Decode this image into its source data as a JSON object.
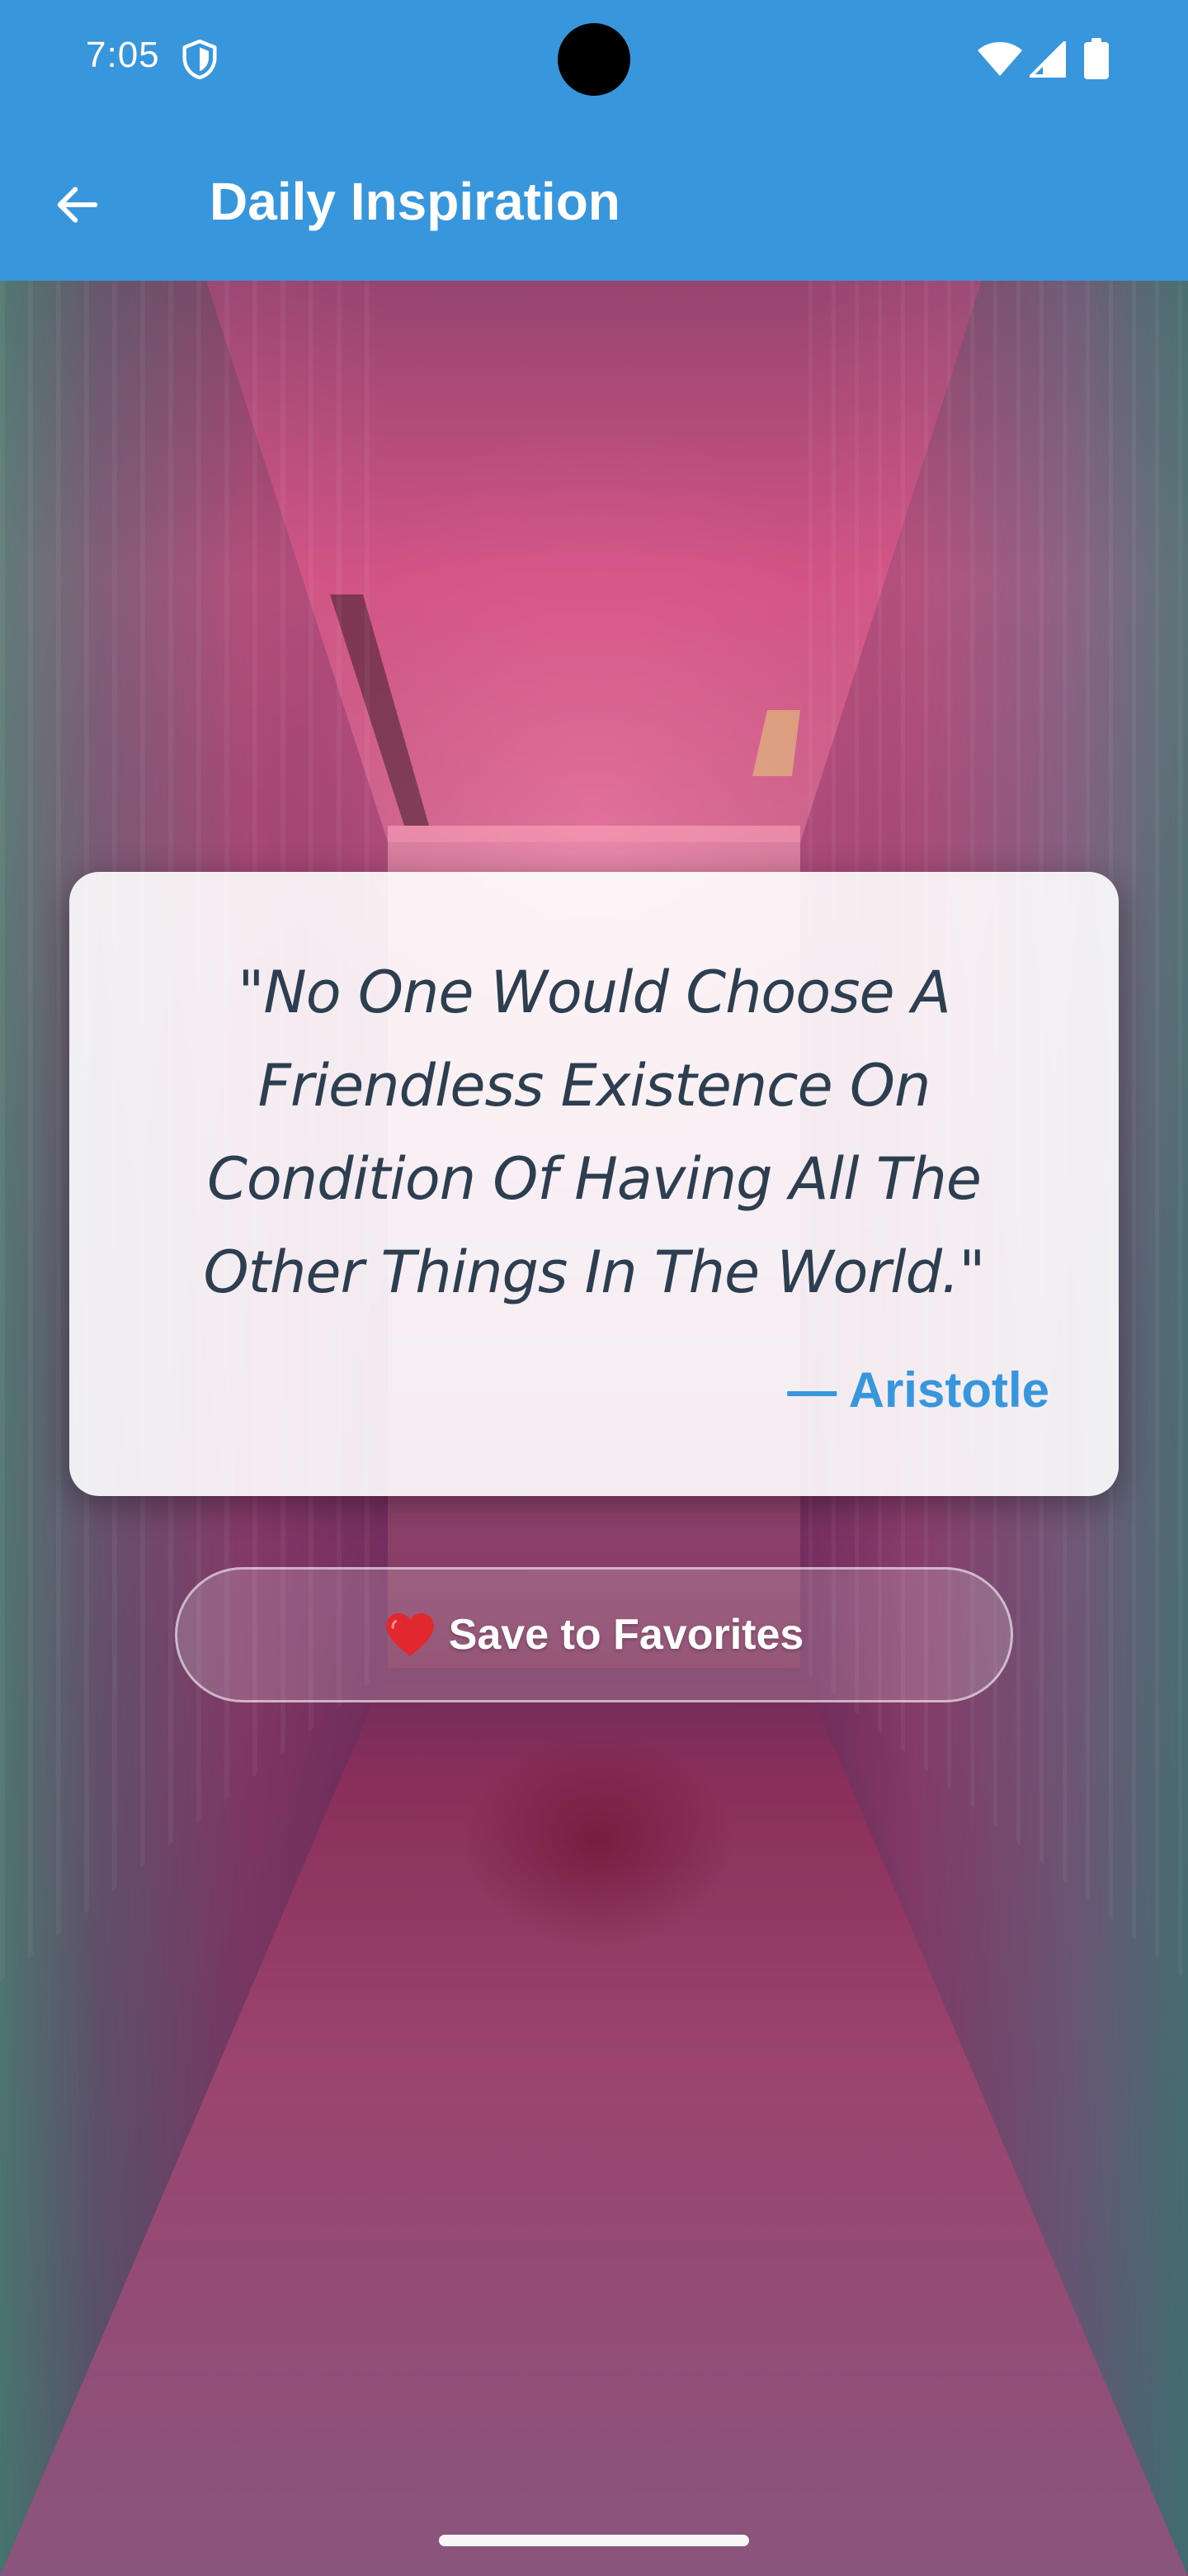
{
  "status_bar": {
    "time": "7:05",
    "icons": [
      "shield-icon",
      "wifi-icon",
      "signal-icon",
      "battery-icon"
    ]
  },
  "app_bar": {
    "title": "Daily Inspiration",
    "back_icon": "arrow-left-icon",
    "color": "#3897dc"
  },
  "quote": {
    "text": "\"No One Would Choose A Friendless Existence On Condition Of Having All The Other Things In The World.\"",
    "author": "— Aristotle",
    "text_color": "#2c3e50",
    "author_color": "#3897dc"
  },
  "actions": {
    "save_icon": "heart-icon",
    "save_label": "Save to Favorites"
  },
  "background": {
    "description_icon": "hallway-photo"
  }
}
